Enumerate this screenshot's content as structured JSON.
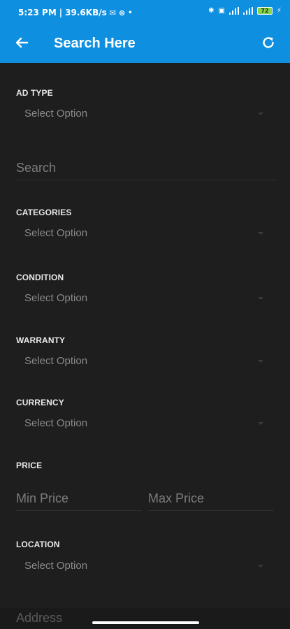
{
  "status": {
    "time": "5:23 PM",
    "speed": "39.6KB/s",
    "battery": "72"
  },
  "appbar": {
    "title": "Search Here",
    "back_icon": "arrow-left-icon",
    "refresh_icon": "refresh-icon"
  },
  "form": {
    "ad_type_label": "AD TYPE",
    "ad_type_value": "Select Option",
    "search_placeholder": "Search",
    "categories_label": "CATEGORIES",
    "categories_value": "Select Option",
    "condition_label": "CONDITION",
    "condition_value": "Select Option",
    "warranty_label": "WARRANTY",
    "warranty_value": "Select Option",
    "currency_label": "CURRENCY",
    "currency_value": "Select Option",
    "price_label": "PRICE",
    "min_price_placeholder": "Min Price",
    "max_price_placeholder": "Max Price",
    "location_label": "LOCATION",
    "location_value": "Select Option",
    "address_placeholder": "Address"
  },
  "colors": {
    "brand": "#0f8fe0",
    "background": "#1e1e1e"
  }
}
